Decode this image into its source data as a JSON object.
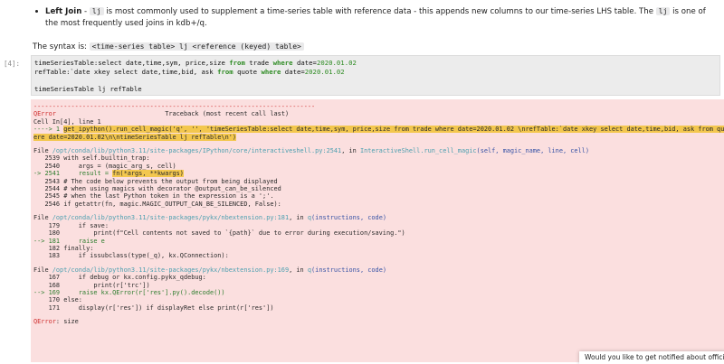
{
  "markdown": {
    "bullet_title": "Left Join",
    "bullet_text_a": " - ",
    "bullet_code_a": "lj",
    "bullet_text_b": " is most commonly used to supplement a time-series table with reference data - this appends new columns to our time-series LHS table. The ",
    "bullet_code_b": "lj",
    "bullet_text_c": " is one of the most frequently used joins in kdb+/q.",
    "syntax_label": "The syntax is: ",
    "syntax_code": "<time-series table> lj <reference (keyed) table>"
  },
  "cell": {
    "prompt": "[4]:",
    "line1_a": "timeSeriesTable:select date,time,sym, price,size ",
    "line1_kw": "from",
    "line1_b": " trade ",
    "line1_kw2": "where",
    "line1_c": " date=",
    "line1_num": "2020.01.02",
    "line2_a": "refTable:`date xkey select date,time,bid, ask ",
    "line2_kw": "from",
    "line2_b": " quote ",
    "line2_kw2": "where",
    "line2_c": " date=",
    "line2_num": "2020.01.02",
    "line3": "timeSeriesTable lj refTable"
  },
  "output": {
    "dashes": "---------------------------------------------------------------------------",
    "error_name": "QError",
    "traceback_header": "                             Traceback (most recent call last)",
    "cell_ref": "Cell In[4], line 1",
    "arrow1": "----> 1 ",
    "arrow1_code": "get_ipython().run_cell_magic('q', '', 'timeSeriesTable:select date,time,sym, price,size from trade where date=2020.01.02 \\nrefTable:`date xkey select date,time,bid, ask from quote wh",
    "arrow1_cont": "ere date=2020.01.02\\n\\ntimeSeriesTable lj refTable\\n')",
    "file1_prefix": "File ",
    "file1_path": "/opt/conda/lib/python3.11/site-packages/IPython/core/interactiveshell.py:2541",
    "file1_mid": ", in ",
    "file1_func": "InteractiveShell.run_cell_magic",
    "file1_args": "(self, magic_name, line, cell)",
    "f1_l1": "   2539 with self.builtin_trap:",
    "f1_l2": "   2540     args = (magic_arg_s, cell)",
    "f1_arrow": "-> 2541     result = ",
    "f1_arrow_hl": "fn(*args, **kwargs)",
    "f1_l4": "   2543 # The code below prevents the output from being displayed",
    "f1_l5": "   2544 # when using magics with decorator @output_can_be_silenced",
    "f1_l6": "   2545 # when the last Python token in the expression is a ';'.",
    "f1_l7": "   2546 if getattr(fn, magic.MAGIC_OUTPUT_CAN_BE_SILENCED, False):",
    "file2_path": "/opt/conda/lib/python3.11/site-packages/pykx/nbextension.py:181",
    "file2_func": "q",
    "file2_args": "(instructions, code)",
    "f2_l1": "    179     if save:",
    "f2_l2": "    180         print(f\"Cell contents not saved to `{path}` due to error during execution/saving.\")",
    "f2_arrow": "--> 181     raise e",
    "f2_l4": "    182 finally:",
    "f2_l5": "    183     if issubclass(type(_q), kx.QConnection):",
    "file3_path": "/opt/conda/lib/python3.11/site-packages/pykx/nbextension.py:169",
    "file3_func": "q",
    "file3_args": "(instructions, code)",
    "f3_l1": "    167     if debug or kx.config.pykx_qdebug:",
    "f3_l2": "    168         print(r['trc'])",
    "f3_arrow": "--> 169     raise kx.QError(r['res'].py().decode())",
    "f3_l4": "    170 else:",
    "f3_l5": "    171     display(r['res']) if displayRet else print(r['res'])",
    "final_error": "QError",
    "final_msg": ": size"
  },
  "toast": {
    "text": "Would you like to get notified about official"
  },
  "colors": {
    "error_bg": "#fbdfdf",
    "input_bg": "#ececec",
    "keyword": "#2e8b23",
    "highlight": "#f3c74e"
  }
}
